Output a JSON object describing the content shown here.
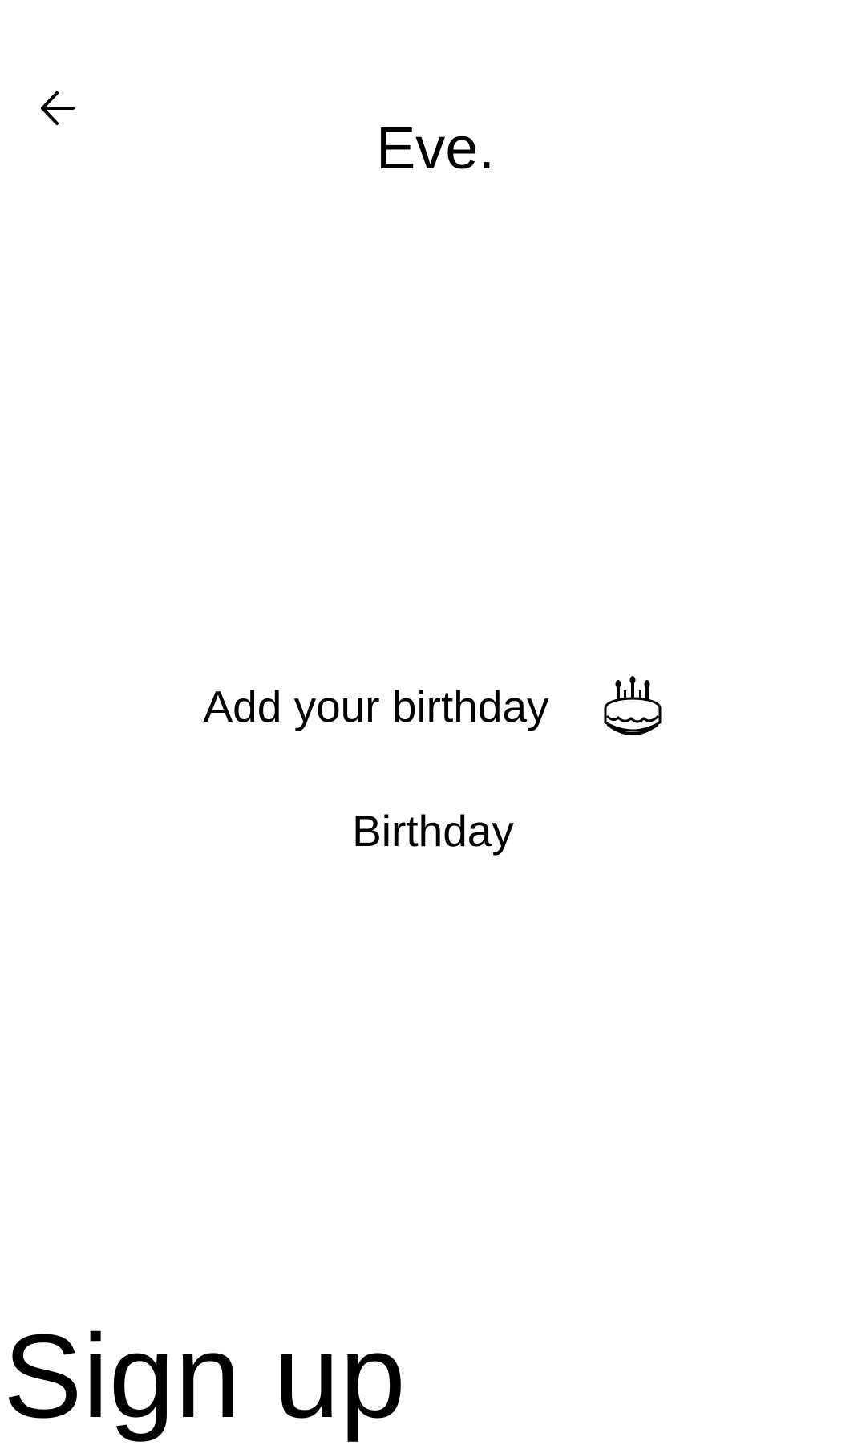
{
  "header": {
    "back_icon": "arrow-left-icon",
    "title": "Eve."
  },
  "main": {
    "prompt": "Add your birthday",
    "prompt_icon": "birthday-cake-icon",
    "birthday_field_placeholder": "Birthday"
  },
  "footer": {
    "heading": "Sign up"
  },
  "colors": {
    "background": "#ffffff",
    "text": "#000000"
  }
}
